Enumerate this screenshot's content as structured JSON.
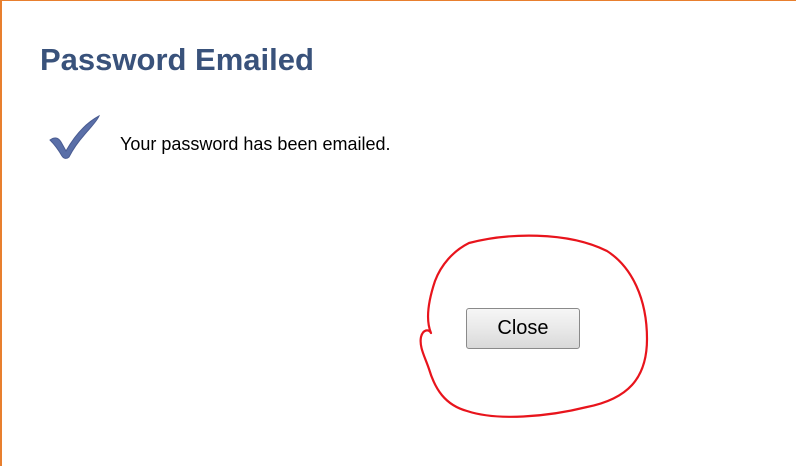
{
  "dialog": {
    "title": "Password Emailed",
    "message": "Your password has been emailed.",
    "close_label": "Close",
    "icon": "checkmark-icon"
  },
  "colors": {
    "title": "#39527b",
    "border": "#e87f2e",
    "checkmark": "#5a6fa8",
    "annotation": "#e8141c"
  }
}
